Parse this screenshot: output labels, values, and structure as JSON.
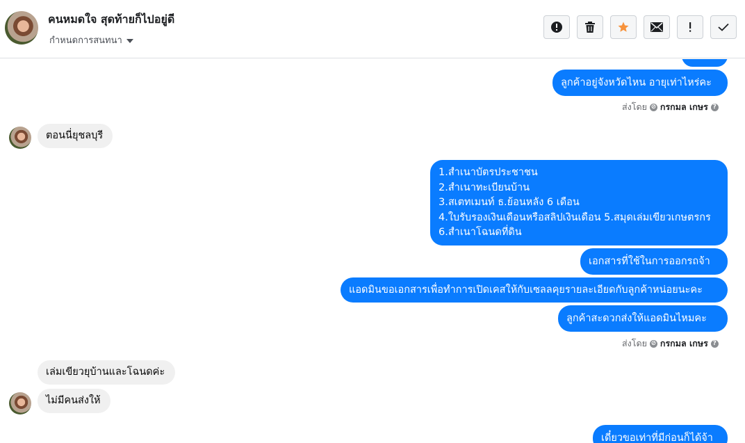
{
  "header": {
    "contact_name": "คนหมดใจ สุดท้ายก็ไปอยู่ดี",
    "assign_label": "กำหนดการสนทนา",
    "toolbar": {
      "spam_icon": "alert-circle-icon",
      "delete_icon": "trash-icon",
      "star_icon": "star-icon",
      "unread_icon": "envelope-icon",
      "important_icon": "exclamation-icon",
      "done_icon": "checkmark-icon",
      "star_color": "#f7923b"
    }
  },
  "messages": [
    {
      "side": "out",
      "text": "ลูกค้าอยู่จังหวัดไหน อายุเท่าไหร่คะ"
    },
    {
      "side": "meta",
      "sent_by_label": "ส่งโดย",
      "sender": "กรกมล เกษร"
    },
    {
      "side": "in",
      "text": "ตอนนี่ยุชลบุรี"
    },
    {
      "side": "out",
      "lines": [
        "1.สำเนาบัตรประชาชน",
        "2.สำเนาทะเบียนบ้าน",
        "3.สเตทเมนท์ ธ.ย้อนหลัง 6 เดือน",
        "4.ใบรับรองเงินเดือนหรือสลิปเงินเดือน 5.สมุดเล่มเขียวเกษตรกร",
        "6.สำเนาโฉนดที่ดิน"
      ]
    },
    {
      "side": "out",
      "text": "เอกสารที่ใช้ในการออกรถจ้า"
    },
    {
      "side": "out",
      "text": "แอดมินขอเอกสารเพื่อทำการเปิดเคสให้กับเซลลคุยรายละเอียดกับลูกค้าหน่อยนะคะ"
    },
    {
      "side": "out",
      "text": "ลูกค้าสะดวกส่งให้แอดมินไหมคะ"
    },
    {
      "side": "meta",
      "sent_by_label": "ส่งโดย",
      "sender": "กรกมล เกษร"
    },
    {
      "side": "in",
      "text": "เล่มเขียวยุบ้านและโฉนดค่ะ"
    },
    {
      "side": "in",
      "text": "ไม่มีคนส่งให้"
    },
    {
      "side": "out",
      "text": "เดี๋ยวขอเท่าที่มีก่อนก็ได้จ้า"
    }
  ],
  "colors": {
    "outgoing": "#0a7cff",
    "incoming": "#f0f0f0"
  }
}
